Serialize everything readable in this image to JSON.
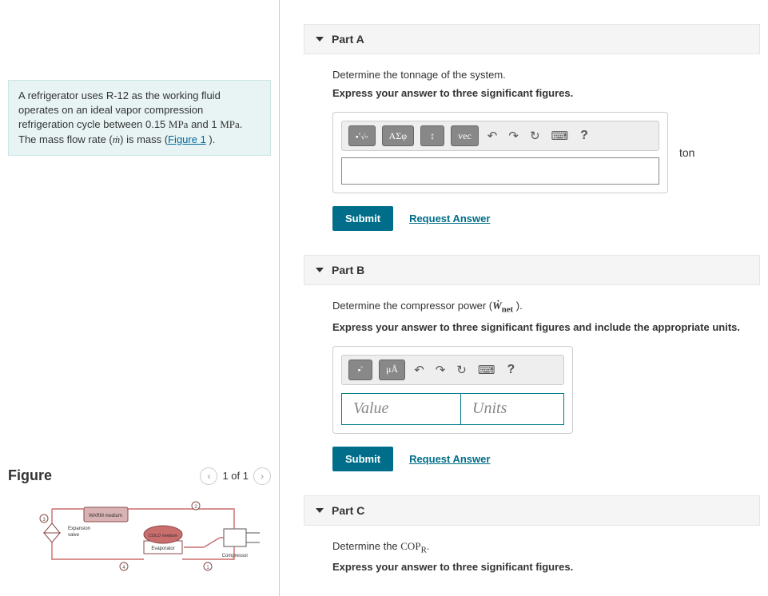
{
  "problem": {
    "text_before": "A refrigerator uses R-12 as the working fluid operates on an ideal vapor compression refrigeration cycle between 0.15 ",
    "mpa1": "MPa",
    "text_mid1": " and 1 ",
    "mpa2": "MPa",
    "text_mid2": ". The mass flow rate (",
    "mdot": "ṁ",
    "text_mid3": ") is mass (",
    "figlink": "Figure 1",
    "text_after": " )."
  },
  "figure": {
    "title": "Figure",
    "pager": "1 of 1",
    "labels": {
      "warm": "WARM medium",
      "cold": "COLD medium",
      "evap": "Evaporator",
      "comp": "Compressor",
      "expv1": "Expansion",
      "expv2": "valve"
    }
  },
  "parts": {
    "A": {
      "title": "Part A",
      "prompt": "Determine the tonnage of the system.",
      "instruct": "Express your answer to three significant figures.",
      "unit": "ton",
      "toolbar": {
        "sigma": "ΑΣφ",
        "vec": "vec"
      },
      "submit": "Submit",
      "request": "Request Answer"
    },
    "B": {
      "title": "Part B",
      "prompt_pre": "Determine the compressor power (",
      "wnet": "Ẇ",
      "wsub": "net",
      "prompt_post": " ).",
      "instruct": "Express your answer to three significant figures and include the appropriate units.",
      "toolbar": {
        "mu": "μÅ"
      },
      "value_ph": "Value",
      "units_ph": "Units",
      "submit": "Submit",
      "request": "Request Answer"
    },
    "C": {
      "title": "Part C",
      "prompt_pre": "Determine the ",
      "cop": "COP",
      "copr": "R",
      "prompt_post": ".",
      "instruct": "Express your answer to three significant figures."
    }
  }
}
